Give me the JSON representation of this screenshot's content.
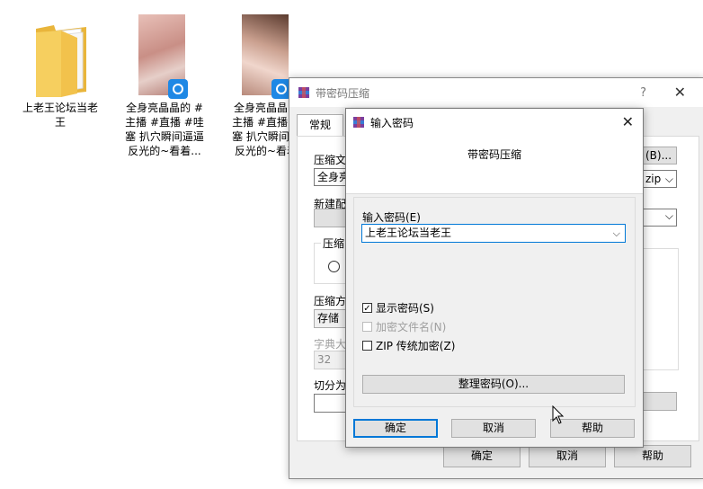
{
  "desktop": {
    "icons": [
      {
        "label": "上老王论坛当老\n王",
        "type": "folder-icon"
      },
      {
        "label": "全身亮晶晶的 #\n主播 #直播 #哇\n塞 扒穴瞬间逼逼\n反光的~看着...",
        "type": "video-thumbnail"
      },
      {
        "label": "全身亮晶晶的\n主播 #直播 #\n塞 扒穴瞬间逼\n反光的~看着",
        "type": "video-thumbnail"
      }
    ]
  },
  "back_dialog": {
    "title": "带密码压缩",
    "help_glyph": "?",
    "close_glyph": "✕",
    "tab_general": "常规",
    "archive_name_label": "压缩文",
    "archive_name_value": "全身亮",
    "browse_btn": "(B)...",
    "format_value": "zip",
    "profile_label": "新建配",
    "compress_group_label": "压缩",
    "method_label": "压缩方",
    "method_value": "存储",
    "dict_label": "字典大",
    "dict_value": "32",
    "split_label": "切分为",
    "ok": "确定",
    "cancel": "取消",
    "help": "帮助"
  },
  "front_dialog": {
    "title": "输入密码",
    "close_glyph": "✕",
    "header": "带密码压缩",
    "password_label": "输入密码(E)",
    "password_value": "上老王论坛当老王",
    "show_password": "显示密码(S)",
    "show_password_checked": true,
    "encrypt_names": "加密文件名(N)",
    "encrypt_names_checked": false,
    "zip_legacy": "ZIP 传统加密(Z)",
    "zip_legacy_checked": false,
    "organize_btn": "整理密码(O)...",
    "ok": "确定",
    "cancel": "取消",
    "help": "帮助"
  },
  "colors": {
    "accent": "#0078d7",
    "dialog_bg": "#f0f0f0",
    "button_bg": "#e1e1e1",
    "folder": "#f5c542"
  }
}
